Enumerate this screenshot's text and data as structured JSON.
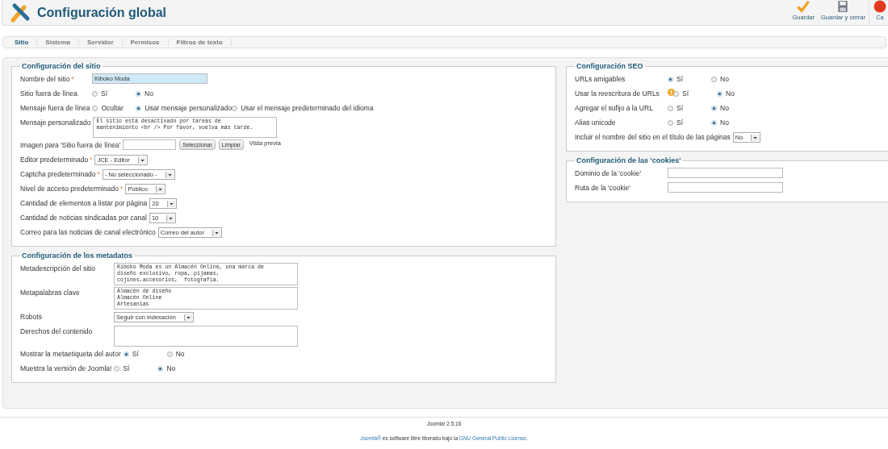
{
  "header": {
    "title": "Configuración global"
  },
  "toolbar": [
    {
      "label": "Guardar",
      "kind": "save"
    },
    {
      "label": "Guardar y cerrar",
      "kind": "save-close"
    },
    {
      "label": "Ca",
      "kind": "cancel"
    }
  ],
  "tabs": [
    {
      "label": "Sitio",
      "selected": true
    },
    {
      "label": "Sistema",
      "selected": false
    },
    {
      "label": "Servidor",
      "selected": false
    },
    {
      "label": "Permisos",
      "selected": false
    },
    {
      "label": "Filtros de texto",
      "selected": false
    }
  ],
  "left_column": [
    {
      "title": "Configuración del sitio",
      "fields": [
        {
          "kind": "text",
          "label": "Nombre del sitio",
          "required_mark": "*",
          "value": "Kiboko Moda",
          "highlighted": true
        },
        {
          "kind": "radio",
          "label": "Sitio fuera de línea",
          "options": [
            {
              "label": "Sí",
              "selected": false
            },
            {
              "label": "No",
              "selected": true
            }
          ]
        },
        {
          "kind": "radio",
          "label": "Mensaje fuera de línea",
          "options": [
            {
              "label": "Ocultar",
              "selected": false
            },
            {
              "label": "Usar mensaje personalizado",
              "selected": true
            },
            {
              "label": "Usar el mensaje predeterminado del idioma",
              "selected": false
            }
          ]
        },
        {
          "kind": "textarea",
          "label": "Mensaje personalizado",
          "value": "El sitio está desactivado por tareas de\nmantenimiento <br /> Por favor, vuelva más tarde."
        },
        {
          "kind": "image",
          "label": "Imagen para 'Sitio fuera de línea'",
          "buttons": [
            "Seleccionar",
            "Limpiar"
          ],
          "preview": "Vista previa"
        },
        {
          "kind": "select",
          "label": "Editor predeterminado",
          "required_mark": "*",
          "value": "JCE - Editor"
        },
        {
          "kind": "select",
          "label": "Captcha predeterminado",
          "required_mark": "*",
          "value": "- No seleccionado -"
        },
        {
          "kind": "select",
          "label": "Nivel de acceso predeterminado",
          "required_mark": "*",
          "value": "Público"
        },
        {
          "kind": "select",
          "label": "Cantidad de elementos a listar por página",
          "value": "20"
        },
        {
          "kind": "select",
          "label": "Cantidad de noticias sindicadas por canal",
          "value": "10"
        },
        {
          "kind": "select",
          "label": "Correo para las noticias de canal electrónico",
          "value": "Correo del autor"
        }
      ]
    },
    {
      "title": "Configuración de los metadatos",
      "fields": [
        {
          "kind": "textarea",
          "label": "Metadescripción del sitio",
          "value": "Kiboko Moda es un Almacén Online, una marca de\ndiseño exclusivo, ropa, pijamas,\ncojines,accesorios,  fotografía."
        },
        {
          "kind": "textarea",
          "label": "Metapalabras clave",
          "value": "Almacén de diseño\nAlmacén Online\nArtesanias"
        },
        {
          "kind": "select",
          "label": "Robots",
          "value": "Seguir con indexación"
        },
        {
          "kind": "textarea",
          "label": "Derechos del contenido"
        },
        {
          "kind": "radio",
          "label": "Mostrar la metaetiqueta del autor",
          "options": [
            {
              "label": "Sí",
              "selected": true
            },
            {
              "label": "No",
              "selected": false
            }
          ]
        },
        {
          "kind": "radio",
          "label": "Muestra la versión de Joomla!",
          "options": [
            {
              "label": "Sí",
              "selected": false
            },
            {
              "label": "No",
              "selected": true
            }
          ]
        }
      ]
    }
  ],
  "right_column": [
    {
      "title": "Configuración SEO",
      "fields": [
        {
          "kind": "radio",
          "label": "URLs amigables",
          "options": [
            {
              "label": "Sí",
              "selected": true
            },
            {
              "label": "No",
              "selected": false
            }
          ]
        },
        {
          "kind": "radio",
          "label": "Usar la reescritura de URLs",
          "warning": true,
          "options": [
            {
              "label": "Sí",
              "selected": false
            },
            {
              "label": "No",
              "selected": true
            }
          ]
        },
        {
          "kind": "radio",
          "label": "Agregar el sufijo a la URL",
          "options": [
            {
              "label": "Sí",
              "selected": false
            },
            {
              "label": "No",
              "selected": true
            }
          ]
        },
        {
          "kind": "radio",
          "label": "Alias unicode",
          "options": [
            {
              "label": "Sí",
              "selected": false
            },
            {
              "label": "No",
              "selected": true
            }
          ]
        },
        {
          "kind": "select",
          "label": "Incluir el nombre del sitio en el título de las páginas",
          "value": "No"
        }
      ]
    },
    {
      "title": "Configuración de las 'cookies'",
      "fields": [
        {
          "kind": "text",
          "label": "Dominio de la 'cookie'"
        },
        {
          "kind": "text",
          "label": "Ruta de la 'cookie'"
        }
      ]
    }
  ],
  "footer": {
    "version": "Joomla! 2.5.16",
    "license": {
      "link_1": "Joomla®",
      "text": " es software libre liberado bajo la ",
      "link_2": "GNU General Public License",
      "end": "."
    }
  }
}
